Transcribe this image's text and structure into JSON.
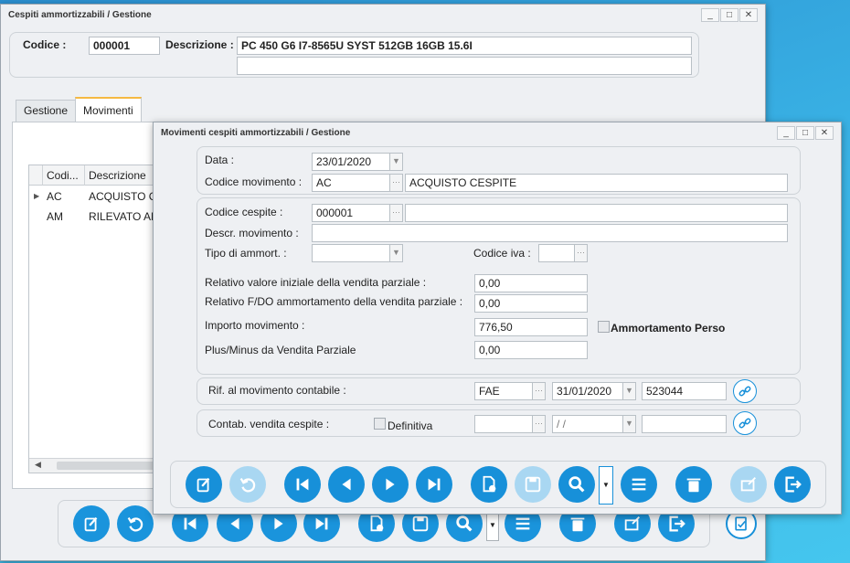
{
  "back_window": {
    "title": "Cespiti ammortizzabili / Gestione",
    "codice_label": "Codice :",
    "codice_value": "000001",
    "descrizione_label": "Descrizione :",
    "descrizione_value": "PC 450 G6 I7-8565U SYST 512GB 16GB 15.6I",
    "descrizione_value2": "",
    "tabs": [
      "Gestione",
      "Movimenti"
    ],
    "active_tab": "Movimenti",
    "grid": {
      "columns": [
        "Codi...",
        "Descrizione"
      ],
      "rows": [
        {
          "code": "AC",
          "desc": "ACQUISTO CE"
        },
        {
          "code": "AM",
          "desc": "RILEVATO AM"
        }
      ]
    }
  },
  "front_window": {
    "title": "Movimenti cespiti ammortizzabili / Gestione",
    "data_label": "Data :",
    "data_value": "23/01/2020",
    "codice_mov_label": "Codice movimento :",
    "codice_mov_value": "AC",
    "codice_mov_desc": "ACQUISTO CESPITE",
    "codice_cespite_label": "Codice cespite :",
    "codice_cespite_value": "000001",
    "codice_cespite_desc": "",
    "descr_mov_label": "Descr. movimento :",
    "descr_mov_value": "",
    "tipo_ammort_label": "Tipo di ammort. :",
    "tipo_ammort_value": "",
    "codice_iva_label": "Codice iva :",
    "codice_iva_value": "",
    "rel_valore_label": "Relativo valore iniziale della vendita parziale :",
    "rel_valore_value": "0,00",
    "rel_fdo_label": "Relativo F/DO ammortamento della vendita parziale :",
    "rel_fdo_value": "0,00",
    "importo_label": "Importo movimento :",
    "importo_value": "776,50",
    "ammortamento_perso_label": "Ammortamento Perso",
    "plus_minus_label": "Plus/Minus da Vendita Parziale",
    "plus_minus_value": "0,00",
    "rif_label": "Rif. al movimento contabile :",
    "rif_tipo": "FAE",
    "rif_data": "31/01/2020",
    "rif_numero": "523044",
    "contab_label": "Contab. vendita cespite :",
    "definitiva_label": "Definitiva",
    "contab_tipo": "",
    "contab_data": " /  /",
    "contab_numero": ""
  },
  "window_controls": {
    "minimize": "_",
    "maximize": "□",
    "close": "✕"
  },
  "colors": {
    "accent": "#1790d9",
    "accent_disabled": "#a9d7f2",
    "background": "#3ab4e6"
  }
}
